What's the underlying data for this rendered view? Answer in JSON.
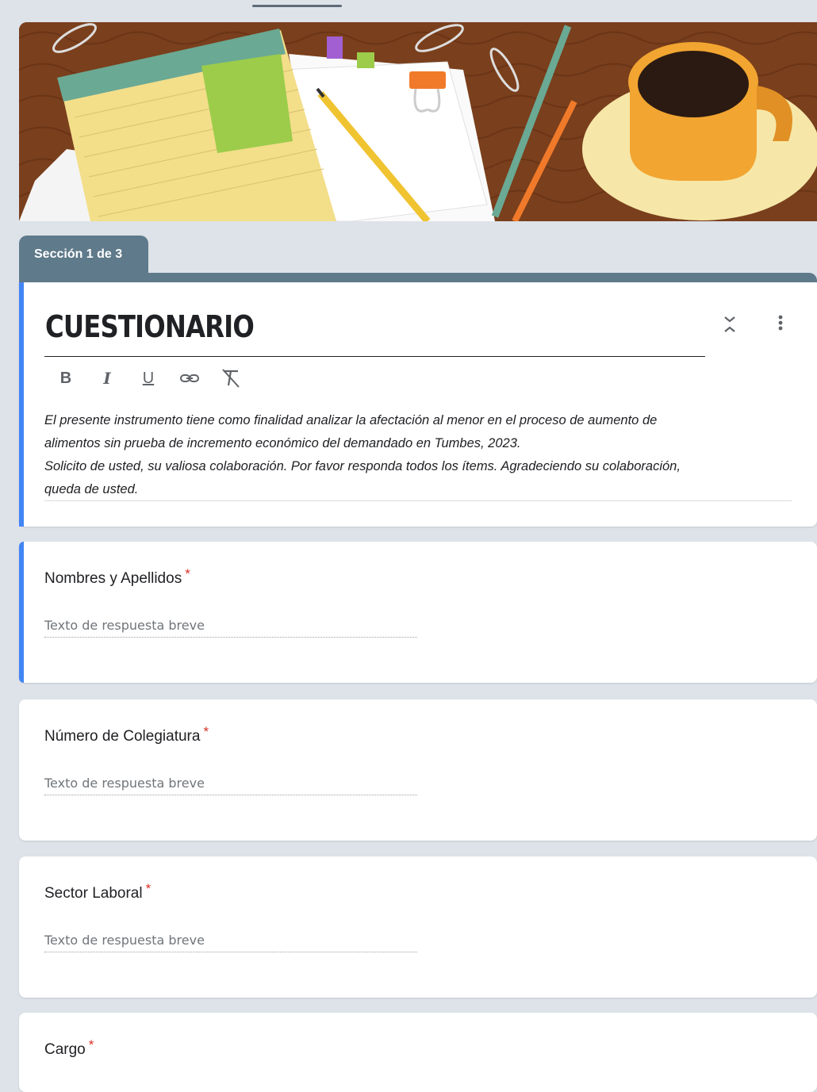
{
  "banner": {
    "colors": {
      "desk": "#7a3f1c",
      "notepad": "#f3de8a",
      "mug": "#f2a531",
      "sticky": "#9ccc4a"
    }
  },
  "section": {
    "label": "Sección 1 de 3"
  },
  "header": {
    "title": "CUESTIONARIO",
    "toolbar": {
      "bold": "B",
      "italic": "I",
      "underline": "U"
    },
    "description_lines": [
      "El presente instrumento tiene como finalidad analizar la afectación al menor en el proceso de aumento de",
      "alimentos sin prueba de incremento económico del demandado en Tumbes, 2023.",
      "Solicito de usted, su valiosa colaboración. Por favor responda todos los ítems. Agradeciendo su colaboración,",
      "queda de usted."
    ]
  },
  "questions": [
    {
      "label": "Nombres y Apellidos",
      "required_mark": "*",
      "placeholder": "Texto de respuesta breve"
    },
    {
      "label": "Número de Colegiatura",
      "required_mark": "*",
      "placeholder": "Texto de respuesta breve"
    },
    {
      "label": "Sector Laboral",
      "required_mark": "*",
      "placeholder": "Texto de respuesta breve"
    },
    {
      "label": "Cargo",
      "required_mark": "*"
    }
  ],
  "colors": {
    "accent": "#4285f4",
    "section": "#5f7a8a",
    "required": "#d93025",
    "background": "#dde3e9"
  }
}
